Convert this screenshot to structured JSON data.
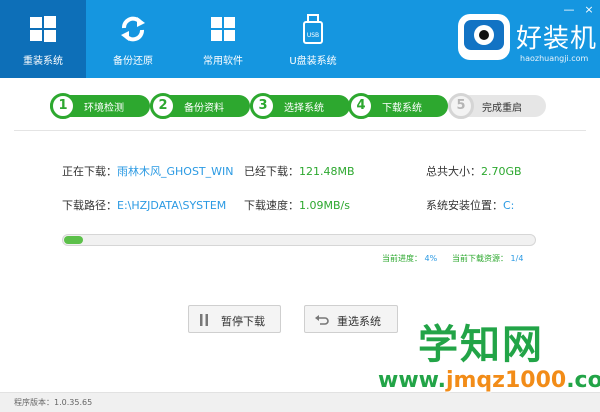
{
  "topbar": {
    "nav": [
      {
        "label": "重装系统",
        "icon": "windows-logo-icon",
        "active": true
      },
      {
        "label": "备份还原",
        "icon": "refresh-icon",
        "active": false
      },
      {
        "label": "常用软件",
        "icon": "apps-grid-icon",
        "active": false
      },
      {
        "label": "U盘装系统",
        "icon": "usb-drive-icon",
        "active": false
      }
    ],
    "usb_icon_text": "USB",
    "logo": {
      "name": "好装机",
      "url": "haozhuangji.com"
    },
    "window_controls": {
      "minimize": "—",
      "close": "×"
    }
  },
  "steps": [
    {
      "number": "1",
      "label": "环境检测",
      "state": "done"
    },
    {
      "number": "2",
      "label": "备份资料",
      "state": "done"
    },
    {
      "number": "3",
      "label": "选择系统",
      "state": "done"
    },
    {
      "number": "4",
      "label": "下载系统",
      "state": "done"
    },
    {
      "number": "5",
      "label": "完成重启",
      "state": "pending"
    }
  ],
  "download": {
    "downloading_label": "正在下载：",
    "downloading_value": "雨林木风_GHOST_WIN",
    "downloaded_label": "已经下载：",
    "downloaded_value": "121.48MB",
    "total_label": "总共大小：",
    "total_value": "2.70GB",
    "path_label": "下载路径：",
    "path_value": "E:\\HZJDATA\\SYSTEM",
    "speed_label": "下载速度：",
    "speed_value": "1.09MB/s",
    "install_location_label": "系统安装位置：",
    "install_location_value": "C:"
  },
  "progress": {
    "percent": 4,
    "current_progress_label": "当前进度：",
    "current_progress_value": "4%",
    "current_resource_label": "当前下载资源：",
    "current_resource_value": "1/4"
  },
  "buttons": {
    "pause_label": "暂停下载",
    "reselect_label": "重选系统"
  },
  "footer": {
    "version_text": "程序版本：1.0.35.65"
  },
  "watermark": {
    "title": "学知网",
    "url_prefix": "www.",
    "url_highlight": "jmqz1000",
    "url_suffix": ".com"
  },
  "colors": {
    "topbar": "#1596e0",
    "active_nav": "#0d6fb8",
    "step_done": "#2da82f",
    "value_blue": "#2b9ae3",
    "progress": "#5cc04a"
  }
}
